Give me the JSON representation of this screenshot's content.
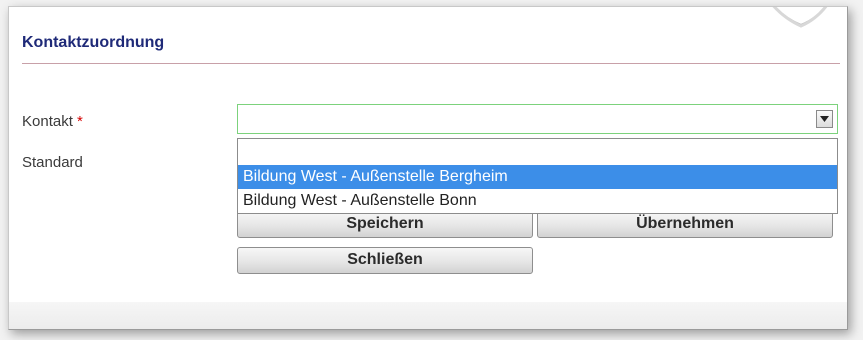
{
  "form": {
    "title": "Kontaktzuordnung",
    "contact_label": "Kontakt",
    "required_mark": "*",
    "standard_label": "Standard",
    "contact_value": ""
  },
  "dropdown": {
    "options": [
      "",
      "Bildung West - Außenstelle Bergheim",
      "Bildung West - Außenstelle Bonn"
    ],
    "highlighted": "Bildung West - Außenstelle Bergheim"
  },
  "buttons": {
    "save": "Speichern",
    "apply": "Übernehmen",
    "close": "Schließen"
  },
  "icons": {
    "dropdown_arrow": "triangle-down-icon",
    "decorative_shape": "shield-outline"
  },
  "colors": {
    "title": "#1f2a78",
    "required": "#d40000",
    "select_border": "#7cd27c",
    "highlight": "#3c8ee8"
  }
}
